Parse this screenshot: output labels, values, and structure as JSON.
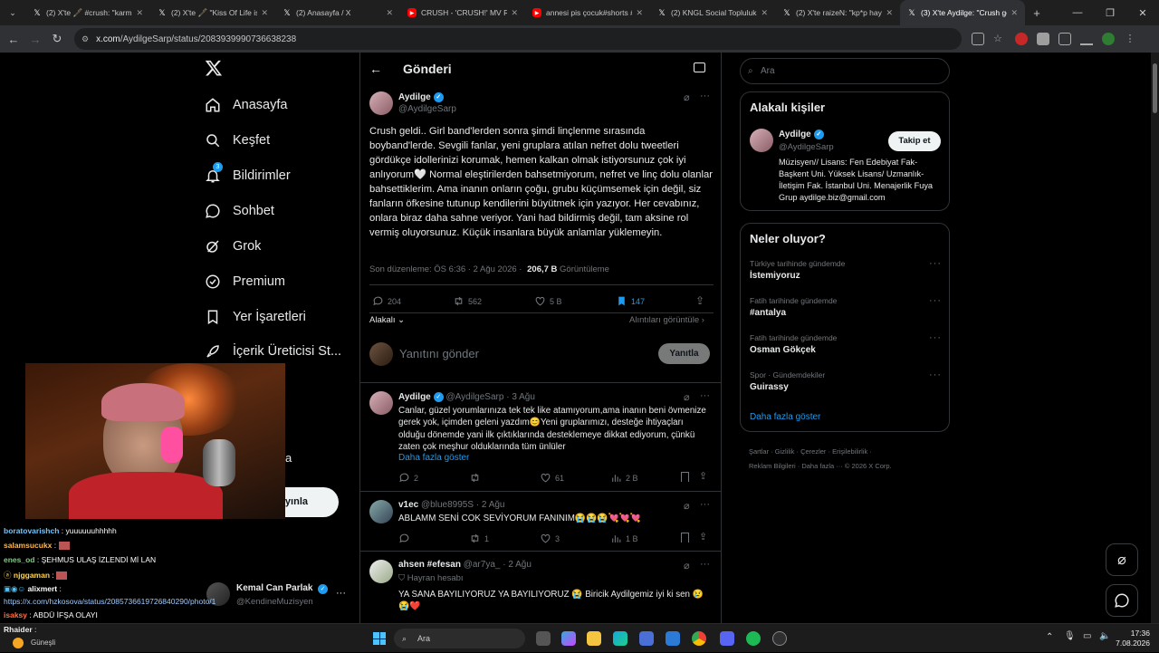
{
  "browser": {
    "tabs": [
      {
        "title": "(2) X'te 🖋️ #crush: \"karmi",
        "icon": "x-logo",
        "active": false
      },
      {
        "title": "(2) X'te 🖋️ \"Kiss Of Life is cu",
        "icon": "x-logo",
        "active": false
      },
      {
        "title": "(2) Anasayfa / X",
        "icon": "x-logo",
        "active": false
      },
      {
        "title": "CRUSH - 'CRUSH!' MV RE",
        "icon": "youtube",
        "active": false
      },
      {
        "title": "annesi pis çocuk#shorts #",
        "icon": "youtube",
        "active": false
      },
      {
        "title": "(2) KNGL Social Topluluk /",
        "icon": "x-logo",
        "active": false
      },
      {
        "title": "(2) X'te raizeN: \"kp*p hayr",
        "icon": "x-logo",
        "active": false
      },
      {
        "title": "(3) X'te Aydilge: \"Crush ge",
        "icon": "x-logo",
        "active": true
      }
    ],
    "url_host": "x.com",
    "url_path": "/AydilgeSarp/status/2083939990736638238"
  },
  "sidebar": {
    "items": [
      {
        "label": "Anasayfa",
        "icon": "home-icon"
      },
      {
        "label": "Keşfet",
        "icon": "search-icon"
      },
      {
        "label": "Bildirimler",
        "icon": "bell-icon",
        "badge": "3"
      },
      {
        "label": "Sohbet",
        "icon": "chat-icon"
      },
      {
        "label": "Grok",
        "icon": "grok-icon"
      },
      {
        "label": "Premium",
        "icon": "premium-icon"
      },
      {
        "label": "Yer İşaretleri",
        "icon": "bookmark-icon"
      },
      {
        "label": "İçerik Üreticisi St...",
        "icon": "rocket-icon"
      }
    ],
    "partial_label_a": "a",
    "post_button": "ıyınla",
    "profile_name": "Kemal Can Parlak",
    "profile_handle": "@KendineMuzisyen"
  },
  "main": {
    "header_title": "Gönderi",
    "tweet": {
      "name": "Aydilge",
      "handle": "@AydilgeSarp",
      "text": "Crush geldi.. Girl band'lerden sonra şimdi linçlenme sırasında boyband'lerde. Sevgili fanlar, yeni gruplara atılan nefret dolu tweetleri gördükçe idollerinizi korumak, hemen kalkan olmak istiyorsunuz çok iyi anlıyorum🤍 Normal eleştirilerden bahsetmiyorum, nefret ve linç dolu olanlar bahsettiklerim. Ama inanın onların çoğu, grubu küçümsemek için değil, siz fanların öfkesine tutunup kendilerini büyütmek için yazıyor. Her cevabınız, onlara biraz daha sahne veriyor. Yani had bildirmiş değil, tam aksine rol vermiş oluyorsunuz. Küçük insanlara büyük anlamlar yüklemeyin.",
      "meta_edited": "Son düzenleme: ÖS 6:36 · 2 Ağu 2026 ·",
      "views_value": "206,7 B",
      "views_label": "Görüntüleme",
      "replies": "204",
      "retweets": "562",
      "likes": "5 B",
      "bookmarks": "147",
      "relevance": "Alakalı",
      "quotes_link": "Alıntıları görüntüle"
    },
    "reply_box": {
      "placeholder": "Yanıtını gönder",
      "button": "Yanıtla"
    },
    "replies": [
      {
        "name": "Aydilge",
        "handle": "@AydilgeSarp",
        "date": "· 3 Ağu",
        "text": "Canlar, güzel yorumlarınıza tek tek like atamıyorum,ama inanın beni övmenize gerek yok, içimden geleni yazdım😊Yeni gruplarımızı, desteğe ihtiyaçları olduğu dönemde yani ilk çıktıklarında desteklemeye dikkat ediyorum, çünkü zaten çok meşhur olduklarında tüm ünlüler",
        "show_more": "Daha fazla göster",
        "replies": "2",
        "retweets": "",
        "likes": "61",
        "views": "2 B"
      },
      {
        "name": "v1ec",
        "handle": "@blue8995S",
        "date": "· 2 Ağu",
        "text": "ABLAMM SENİ COK SEVİYORUM FANINIM😭😭😭💘💘💘",
        "replies": "",
        "retweets": "1",
        "likes": "3",
        "views": "1 B"
      },
      {
        "name": "ahsen #efesan",
        "handle": "@ar7ya_",
        "date": "· 2 Ağu",
        "subtitle": "Hayran hesabı",
        "text": "YA SANA BAYILIYORUZ YA BAYILIYORUZ 😭 Biricik Aydilgemiz iyi ki sen 😢😭❤️"
      }
    ]
  },
  "right": {
    "search_placeholder": "Ara",
    "related_title": "Alakalı kişiler",
    "person": {
      "name": "Aydilge",
      "handle": "@AydilgeSarp",
      "follow": "Takip et",
      "bio": "Müzisyen// Lisans: Fen Edebiyat Fak- Başkent Uni. Yüksek Lisans/ Uzmanlık- İletişim Fak. İstanbul Uni. Menajerlik Fuya Grup aydilge.biz@gmail.com"
    },
    "trends_title": "Neler oluyor?",
    "trends": [
      {
        "category": "Türkiye tarihinde gündemde",
        "name": "İstemiyoruz"
      },
      {
        "category": "Fatih tarihinde gündemde",
        "name": "#antalya"
      },
      {
        "category": "Fatih tarihinde gündemde",
        "name": "Osman Gökçek"
      },
      {
        "category": "Spor · Gündemdekiler",
        "name": "Guirassy"
      }
    ],
    "show_more": "Daha fazla göster",
    "footer_line1": "Şartlar · Gizlilik · Çerezler · Erişilebilirlik ·",
    "footer_line2": "Reklam Bilgileri · Daha fazla ··· © 2026 X Corp."
  },
  "chat": [
    {
      "user": "boratovarishch",
      "msg": ": yuuuuuuhhhhh",
      "color": "#6ec6ff"
    },
    {
      "user": "salamsucukx",
      "msg": ":",
      "color": "#ffb74d"
    },
    {
      "user": "enes_od",
      "msg": ": ŞEHMUS ULAŞ İZLENDİ Mİ LAN",
      "color": "#81c784"
    },
    {
      "user": "njggaman",
      "msg": ":",
      "color": "#ffd54f"
    },
    {
      "user": "alixmert",
      "msg": ":",
      "color": "#ffffff"
    },
    {
      "user": "",
      "msg": "https://x.com/hzkosova/status/2085736619726840290/photo/1",
      "color": "#9ecbff"
    },
    {
      "user": "isaksy",
      "msg": ": ABDÜ İFŞA OLAYI",
      "color": "#ff7043"
    },
    {
      "user": "Rhaider",
      "msg": ":",
      "color": "#ffffff"
    }
  ],
  "taskbar": {
    "weather": "Güneşli",
    "search": "Ara",
    "time": "17:36",
    "date": "7.08.2026"
  },
  "colors": {
    "accent": "#1d9bf0",
    "bg": "#000000",
    "border": "#2f3336",
    "muted": "#71767b"
  }
}
